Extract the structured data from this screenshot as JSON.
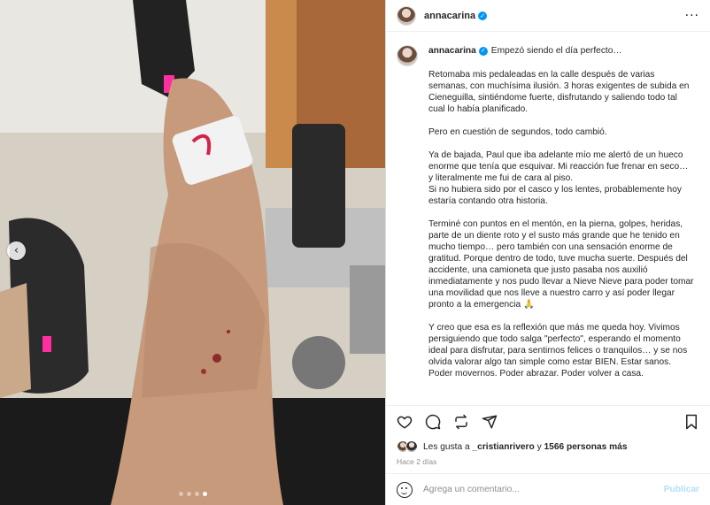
{
  "post": {
    "username": "annacarina",
    "more_icon": "more-horizontal-icon"
  },
  "caption": {
    "username": "annacarina",
    "title": "Empezó siendo el día perfecto…",
    "paragraphs": [
      "Retomaba mis pedaleadas en la calle después de varias semanas, con muchísima ilusión. 3 horas exigentes de subida en Cieneguilla, sintiéndome fuerte, disfrutando y saliendo todo tal cual lo había planificado.",
      "Pero en cuestión de segundos, todo cambió.",
      "Ya de bajada, Paul que iba adelante mío me alertó de un hueco enorme que tenía que esquivar. Mi reacción fue frenar en seco… y literalmente me fui de cara al piso.\nSi no hubiera sido por el casco y los lentes, probablemente hoy estaría contando otra historia.",
      "Terminé con puntos en el mentón, en la pierna, golpes, heridas, parte de un diente roto y el susto más grande que he tenido en mucho tiempo… pero también con una sensación enorme de gratitud. Porque dentro de todo, tuve mucha suerte. Después del accidente, una camioneta que justo pasaba nos auxilió inmediatamente y nos pudo llevar a Nieve Nieve para poder tomar una movilidad que nos lleve a nuestro carro y así poder llegar pronto a la emergencia 🙏",
      "Y creo que esa es la reflexión que más me queda hoy. Vivimos persiguiendo que todo salga \"perfecto\", esperando el momento ideal para disfrutar, para sentirnos felices o tranquilos… y se nos olvida valorar algo tan simple como estar BIEN. Estar sanos. Poder movernos. Poder abrazar. Poder volver a casa."
    ]
  },
  "actions": {
    "like_icon": "heart-icon",
    "comment_icon": "comment-icon",
    "share_icon": "repost-icon",
    "send_icon": "send-icon",
    "save_icon": "bookmark-icon"
  },
  "likes": {
    "prefix": "Les gusta a ",
    "user": "_cristianrivero",
    "middle": " y ",
    "count": "1566 personas más"
  },
  "time": "Hace 2 días",
  "comment_box": {
    "placeholder": "Agrega un comentario...",
    "publish": "Publicar"
  },
  "carousel": {
    "slide_count": 4,
    "active_index": 3
  }
}
